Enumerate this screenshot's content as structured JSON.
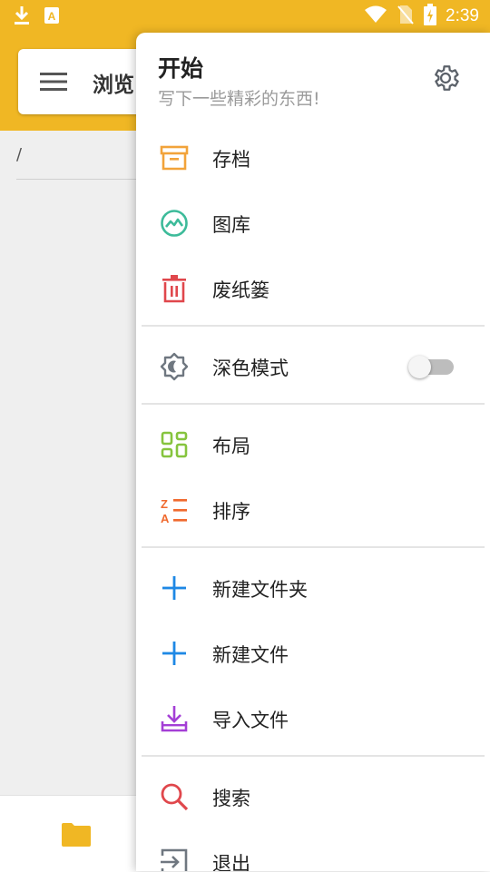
{
  "status_bar": {
    "time": "2:39",
    "icons": [
      "download-icon",
      "autofill-icon",
      "wifi-icon",
      "no-sim-icon",
      "battery-charging-icon"
    ]
  },
  "app_header": {
    "title": "浏览"
  },
  "path": {
    "current": "/"
  },
  "bottom_nav": {
    "icons": [
      "folder-icon"
    ]
  },
  "drawer": {
    "title": "开始",
    "subtitle": "写下一些精彩的东西!",
    "items": [
      {
        "label": "存档",
        "icon": "archive-icon",
        "color": "#f2a33a"
      },
      {
        "label": "图库",
        "icon": "gallery-icon",
        "color": "#3dbb9a"
      },
      {
        "label": "废纸篓",
        "icon": "trash-icon",
        "color": "#e0474c"
      },
      {
        "label": "深色模式",
        "icon": "dark-mode-icon",
        "color": "#6f7780",
        "toggle": false
      },
      {
        "label": "布局",
        "icon": "layout-icon",
        "color": "#86c43e"
      },
      {
        "label": "排序",
        "icon": "sort-icon",
        "color": "#f06a2f"
      },
      {
        "label": "新建文件夹",
        "icon": "plus-icon",
        "color": "#1e88e5"
      },
      {
        "label": "新建文件",
        "icon": "plus-icon",
        "color": "#1e88e5"
      },
      {
        "label": "导入文件",
        "icon": "import-icon",
        "color": "#a43fd6"
      },
      {
        "label": "搜索",
        "icon": "search-icon",
        "color": "#e0474c"
      },
      {
        "label": "退出",
        "icon": "exit-icon",
        "color": "#6f7780"
      }
    ]
  },
  "colors": {
    "accent": "#f0b724"
  }
}
